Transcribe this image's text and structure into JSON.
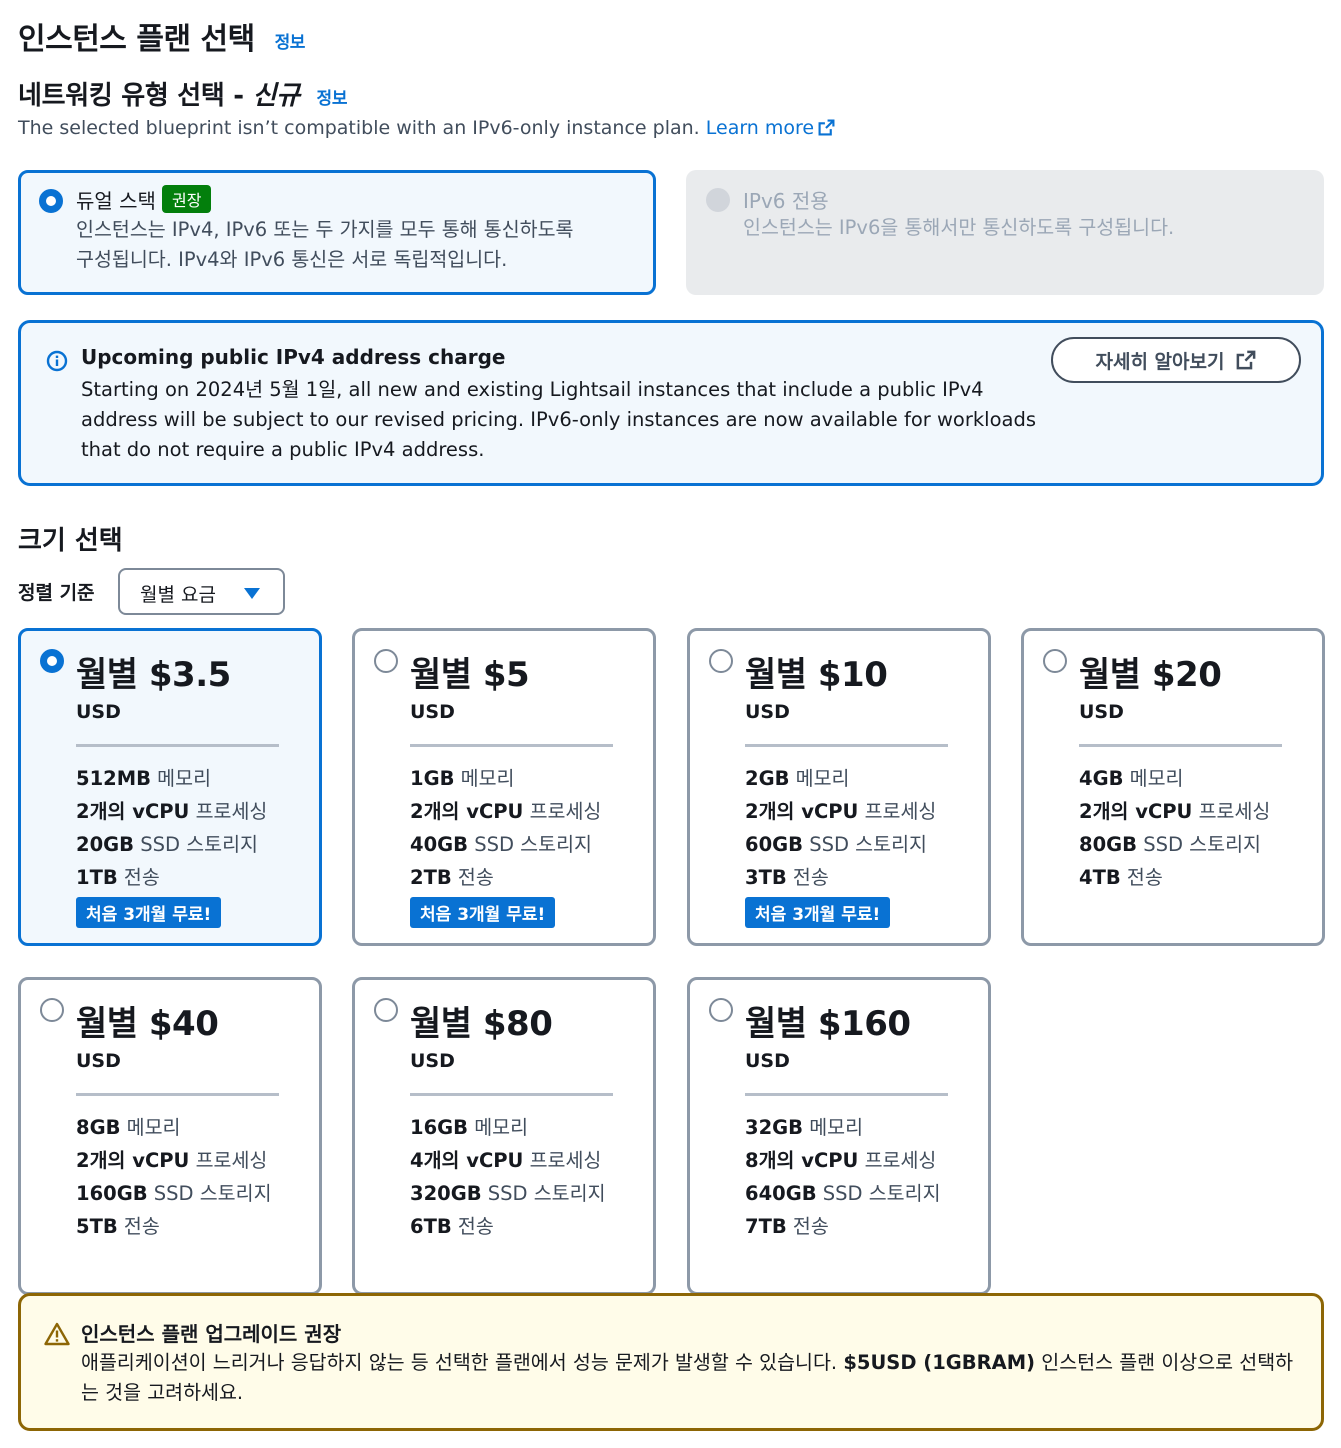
{
  "header": {
    "title": "인스턴스 플랜 선택",
    "info": "정보"
  },
  "networking": {
    "title": "네트워킹 유형 선택 - ",
    "title_new": "신규",
    "info": "정보",
    "description": "The selected blueprint isn’t compatible with an IPv6-only instance plan.",
    "learn_more": "Learn more",
    "options": [
      {
        "label": "듀얼 스택",
        "badge": "권장",
        "selected": true,
        "disabled": false,
        "line1": "인스턴스는 IPv4, IPv6 또는 두 가지를 모두 통해 통신하도록",
        "line2": "구성됩니다. IPv4와 IPv6 통신은 서로 독립적입니다."
      },
      {
        "label": "IPv6 전용",
        "selected": false,
        "disabled": true,
        "line1": "인스턴스는 IPv6을 통해서만 통신하도록 구성됩니다."
      }
    ]
  },
  "ipv4_alert": {
    "title": "Upcoming public IPv4 address charge",
    "line1": "Starting on 2024년 5월 1일, all new and existing Lightsail instances that include a public IPv4",
    "line2": "address will be subject to our revised pricing. IPv6-only instances are now available for workloads",
    "line3": "that do not require a public IPv4 address.",
    "button": "자세히 알아보기"
  },
  "size": {
    "title": "크기 선택",
    "sort_label": "정렬 기준",
    "sort_value": "월별 요금"
  },
  "plans": [
    {
      "price": "월별 $3.5",
      "currency": "USD",
      "memory": "512MB",
      "memory_label": " 메모리",
      "vcpu": "2개의 vCPU",
      "vcpu_label": " 프로세싱",
      "storage": "20GB",
      "storage_label": " SSD 스토리지",
      "transfer": "1TB",
      "transfer_label": " 전송",
      "promo": "처음 3개월 무료!",
      "selected": true
    },
    {
      "price": "월별 $5",
      "currency": "USD",
      "memory": "1GB",
      "memory_label": " 메모리",
      "vcpu": "2개의 vCPU",
      "vcpu_label": " 프로세싱",
      "storage": "40GB",
      "storage_label": " SSD 스토리지",
      "transfer": "2TB",
      "transfer_label": " 전송",
      "promo": "처음 3개월 무료!",
      "selected": false
    },
    {
      "price": "월별 $10",
      "currency": "USD",
      "memory": "2GB",
      "memory_label": " 메모리",
      "vcpu": "2개의 vCPU",
      "vcpu_label": " 프로세싱",
      "storage": "60GB",
      "storage_label": " SSD 스토리지",
      "transfer": "3TB",
      "transfer_label": " 전송",
      "promo": "처음 3개월 무료!",
      "selected": false
    },
    {
      "price": "월별 $20",
      "currency": "USD",
      "memory": "4GB",
      "memory_label": " 메모리",
      "vcpu": "2개의 vCPU",
      "vcpu_label": " 프로세싱",
      "storage": "80GB",
      "storage_label": " SSD 스토리지",
      "transfer": "4TB",
      "transfer_label": " 전송",
      "selected": false
    },
    {
      "price": "월별 $40",
      "currency": "USD",
      "memory": "8GB",
      "memory_label": " 메모리",
      "vcpu": "2개의 vCPU",
      "vcpu_label": " 프로세싱",
      "storage": "160GB",
      "storage_label": " SSD 스토리지",
      "transfer": "5TB",
      "transfer_label": " 전송",
      "selected": false
    },
    {
      "price": "월별 $80",
      "currency": "USD",
      "memory": "16GB",
      "memory_label": " 메모리",
      "vcpu": "4개의 vCPU",
      "vcpu_label": " 프로세싱",
      "storage": "320GB",
      "storage_label": " SSD 스토리지",
      "transfer": "6TB",
      "transfer_label": " 전송",
      "selected": false
    },
    {
      "price": "월별 $160",
      "currency": "USD",
      "memory": "32GB",
      "memory_label": " 메모리",
      "vcpu": "8개의 vCPU",
      "vcpu_label": " 프로세싱",
      "storage": "640GB",
      "storage_label": " SSD 스토리지",
      "transfer": "7TB",
      "transfer_label": " 전송",
      "selected": false
    }
  ],
  "upgrade_alert": {
    "title": "인스턴스 플랜 업그레이드 권장",
    "body_before": "애플리케이션이 느리거나 응답하지 않는 등 선택한 플랜에서 성능 문제가 발생할 수 있습니다. ",
    "body_bold": "$5USD (1GBRAM)",
    "body_after": " 인스턴스 플랜 이상으로 선택하는 것을 고려하세요."
  },
  "colors": {
    "accent": "#0972d3",
    "recommended_badge": "#037f0c",
    "warning_border": "#8d6605"
  }
}
